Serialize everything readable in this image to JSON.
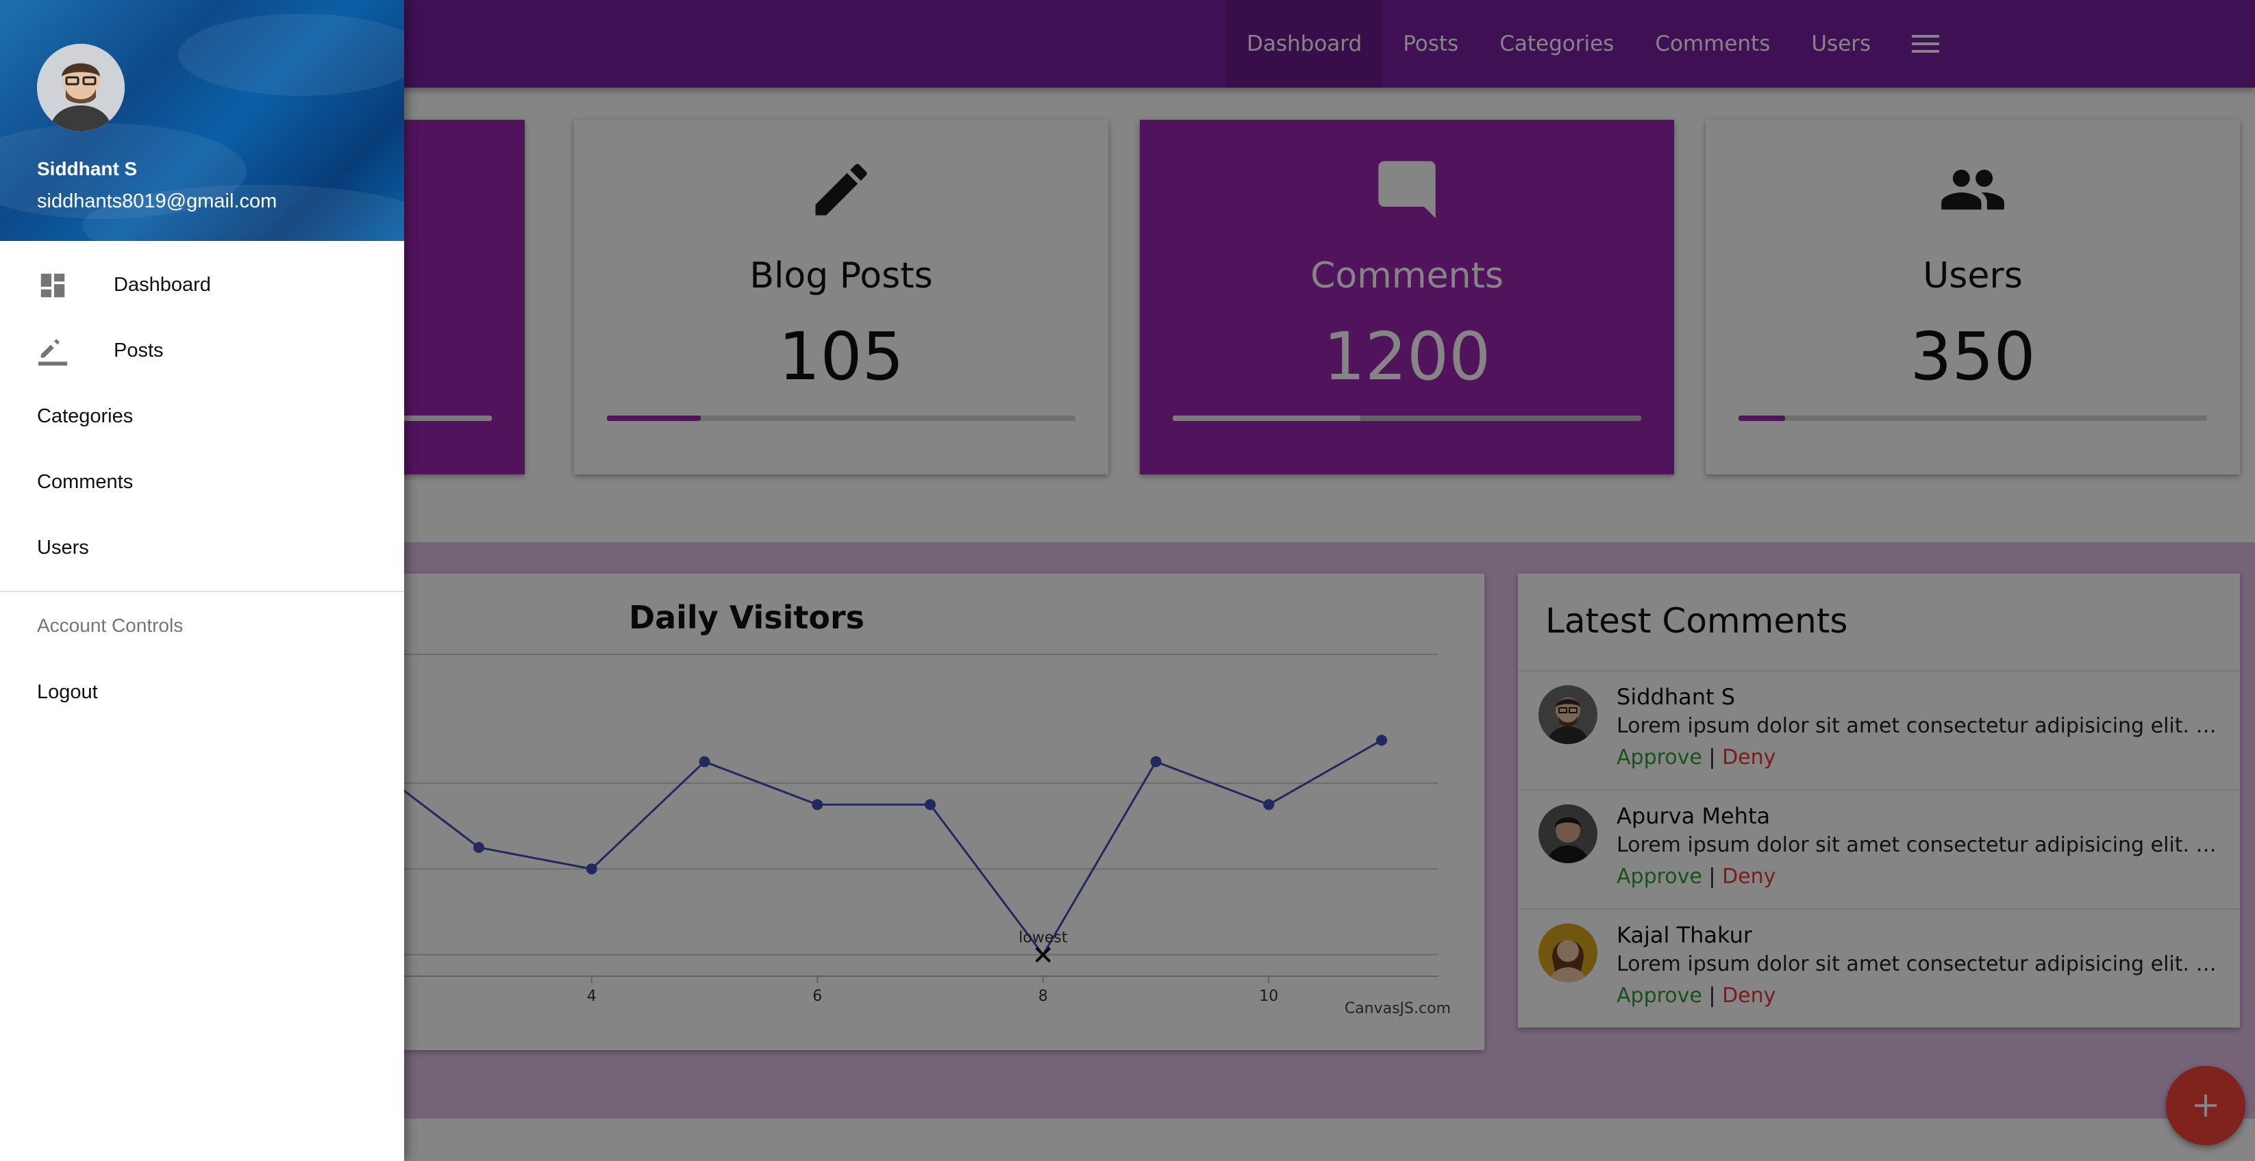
{
  "topnav": {
    "items": [
      "Dashboard",
      "Posts",
      "Categories",
      "Comments",
      "Users"
    ],
    "active_index": 0,
    "menu_icon": "hamburger-menu-icon"
  },
  "stats": [
    {
      "title": "Blog Posts",
      "value": "105",
      "icon": "pencil-icon",
      "progress": 0.2
    },
    {
      "title": "Comments",
      "value": "1200",
      "icon": "comment-icon",
      "progress": 0.4
    },
    {
      "title": "Users",
      "value": "350",
      "icon": "group-icon",
      "progress": 0.1
    }
  ],
  "first_card_progress": 1.0,
  "chart_data": {
    "type": "line",
    "title": "Daily Visitors",
    "x": [
      2,
      3,
      4,
      5,
      6,
      7,
      8,
      9,
      10,
      11
    ],
    "y": [
      460,
      380,
      360,
      460,
      420,
      420,
      280,
      460,
      420,
      480
    ],
    "xticks": [
      "4",
      "6",
      "8",
      "10"
    ],
    "ylim": [
      260,
      560
    ],
    "grid": true,
    "annotation": {
      "x": 8,
      "label": "lowest",
      "marker": "cross"
    },
    "credit": "CanvasJS.com",
    "color": "#3f51b5"
  },
  "latest_comments": {
    "title": "Latest Comments",
    "items": [
      {
        "name": "Siddhant S",
        "text": "Lorem ipsum dolor sit amet consectetur adipisicing elit. Nesciunt, voluptatum.",
        "approve": "Approve",
        "separator": "|",
        "deny": "Deny"
      },
      {
        "name": "Apurva Mehta",
        "text": "Lorem ipsum dolor sit amet consectetur adipisicing elit. Nesciunt, voluptatum.",
        "approve": "Approve",
        "separator": "|",
        "deny": "Deny"
      },
      {
        "name": "Kajal Thakur",
        "text": "Lorem ipsum dolor sit amet consectetur adipisicing elit. Nesciunt, voluptatum.",
        "approve": "Approve",
        "separator": "|",
        "deny": "Deny"
      }
    ]
  },
  "fab": {
    "icon": "plus-icon"
  },
  "drawer": {
    "user_name": "Siddhant S",
    "user_email": "siddhants8019@gmail.com",
    "items": [
      {
        "label": "Dashboard",
        "icon": "dashboard-icon"
      },
      {
        "label": "Posts",
        "icon": "edit-icon"
      },
      {
        "label": "Categories"
      },
      {
        "label": "Comments"
      },
      {
        "label": "Users"
      }
    ],
    "account_header": "Account Controls",
    "logout_label": "Logout"
  },
  "colors": {
    "primary": "#7b1fa2",
    "accent_card": "#9c27b0",
    "band": "#e1bee7",
    "approve": "#2e9e2e",
    "deny": "#e53935",
    "fab": "#f44336"
  }
}
